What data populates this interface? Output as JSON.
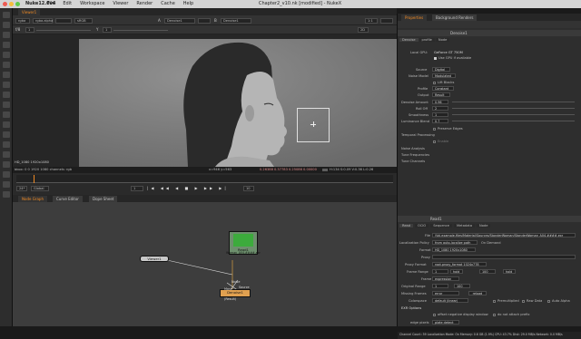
{
  "window": {
    "app_name": "Nuke12.0v4",
    "title": "Chapter2_v10.nk [modified] - NukeX"
  },
  "menu": [
    "File",
    "Edit",
    "Workspace",
    "Viewer",
    "Render",
    "Cache",
    "Help"
  ],
  "viewer": {
    "tab_label": "Viewer1",
    "channels": "rgba",
    "alpha": "rgba.alpha",
    "colorspace": "sRGB",
    "input_a": "A",
    "input_a_node": "Denoise1",
    "input_b": "B",
    "input_b_node": "Denoise1",
    "zoom": "1:1",
    "gain_label": "f/8",
    "gain_value": "1",
    "gamma_label": "Y",
    "gamma_value": "1",
    "clip_label": "2D",
    "format_label": "HD_1080 1920x1080",
    "bbox_label": "bbox: 0 0 1920 1080 channels: rgb",
    "cursor_label": "x=946 y=563",
    "pixel_values": "0.26388  0.37783  0.25086  0.00000",
    "hsv_values": "H:134 S:0.09 V:0.36  L:0.26"
  },
  "timeline": {
    "fps_value": "24*",
    "range_mode": "Global",
    "frame_value": "1",
    "step_value": "10"
  },
  "graph": {
    "tabs": [
      "Node Graph",
      "Curve Editor",
      "Dope Sheet"
    ],
    "nodes": {
      "viewer": "Viewer1",
      "read_name": "Read1",
      "read_file": "Woman_A04.####.exr",
      "denoise_name": "Denoise1",
      "denoise_sub": "(Result)"
    },
    "labels": {
      "noise": "Noise",
      "mask": "Mask",
      "source": "Source"
    }
  },
  "properties": {
    "tabs": [
      "Properties",
      "Background Renders"
    ],
    "denoise": {
      "title": "Denoise1",
      "tabs": [
        "Denoise",
        "profile",
        "Node"
      ],
      "local_gpu_label": "Local GPU:",
      "local_gpu_value": "GeForce GT 750M",
      "use_gpu_label": "Use GPU if available",
      "source_label": "Source",
      "source_value": "Digital",
      "noise_model_label": "Noise Model",
      "noise_model_value": "Modulated",
      "lift_blacks_label": "Lift Blacks",
      "profile_label": "Profile",
      "profile_value": "Constant",
      "output_label": "Output",
      "output_value": "Result",
      "denoise_amount_label": "Denoise Amount",
      "denoise_amount_value": "0.96",
      "roll_off_label": "Roll Off",
      "roll_off_value": "2",
      "smoothness_label": "Smoothness",
      "smoothness_value": "1",
      "luminance_blend_label": "Luminance Blend",
      "luminance_blend_value": "0.7",
      "preserve_edges_label": "Preserve Edges",
      "temporal_label": "Temporal Processing",
      "enable_label": "Enable",
      "noise_analysis_label": "Noise Analysis",
      "tune_frequencies_label": "Tune Frequencies",
      "tune_channels_label": "Tune Channels"
    },
    "read": {
      "title": "Read1",
      "tabs": [
        "Read",
        "OCIO",
        "Sequence",
        "Metadata",
        "Node"
      ],
      "file_label": "File",
      "file_value": "/Vol.example.files/Material/Sources/StonderWoman/StonderWoman_A04.####.exr",
      "localization_policy_label": "Localization Policy",
      "localization_policy_value": "from auto-localize path",
      "localization_status": "On Demand",
      "format_label": "Format",
      "format_value": "HD_1080 1920x1080",
      "proxy_label": "Proxy",
      "proxy_format_label": "Proxy Format",
      "proxy_format_value": "root.proxy_format 1024x778",
      "frame_range_label": "Frame Range",
      "frame_range_start": "1",
      "frame_range_before": "hold",
      "frame_range_end": "100",
      "frame_range_after": "hold",
      "frame_label": "Frame",
      "frame_value": "expression",
      "original_range_label": "Original Range",
      "original_range_start": "1",
      "original_range_end": "100",
      "missing_frames_label": "Missing Frames",
      "missing_frames_value": "error",
      "reload_label": "reload",
      "colorspace_label": "Colorspace",
      "colorspace_value": "default (linear)",
      "premultiplied_label": "Premultiplied",
      "raw_data_label": "Raw Data",
      "auto_alpha_label": "Auto Alpha",
      "exr_options_label": "EXR Options",
      "offset_label": "offset negative display window",
      "no_attach_label": "do not attach prefix",
      "edge_pixels_label": "edge pixels",
      "edge_pixels_value": "plate detect"
    }
  },
  "status_bar": "Channel Count: 59  Localization Mode: On  Memory: 0.6 GB (1.9%)  CPU: 43.7%  Disk: 29.0 MB/s  Network: 0.0 MB/s"
}
